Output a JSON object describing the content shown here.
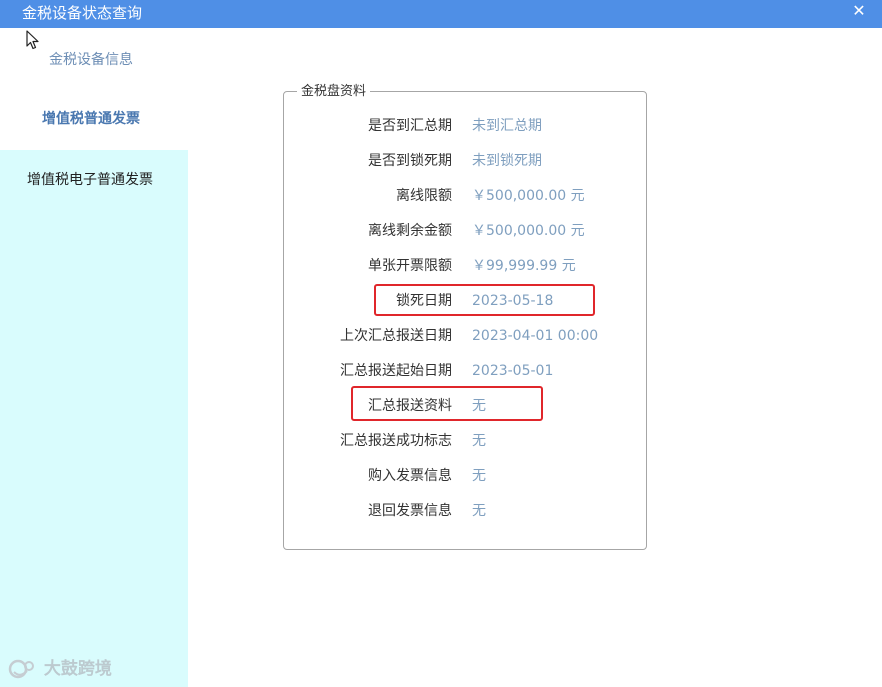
{
  "window": {
    "title": "金税设备状态查询",
    "close_icon": "close-icon"
  },
  "sidebar": {
    "items": [
      {
        "label": "金税设备信息"
      },
      {
        "label": "增值税普通发票"
      },
      {
        "label": "增值税电子普通发票"
      }
    ]
  },
  "panel": {
    "legend": "金税盘资料",
    "rows": [
      {
        "label": "是否到汇总期",
        "value": "未到汇总期"
      },
      {
        "label": "是否到锁死期",
        "value": "未到锁死期"
      },
      {
        "label": "离线限额",
        "value": "￥500,000.00 元"
      },
      {
        "label": "离线剩余金额",
        "value": "￥500,000.00 元"
      },
      {
        "label": "单张开票限额",
        "value": "￥99,999.99 元"
      },
      {
        "label": "锁死日期",
        "value": "2023-05-18"
      },
      {
        "label": "上次汇总报送日期",
        "value": "2023-04-01 00:00"
      },
      {
        "label": "汇总报送起始日期",
        "value": "2023-05-01"
      },
      {
        "label": "汇总报送资料",
        "value": "无"
      },
      {
        "label": "汇总报送成功标志",
        "value": "无"
      },
      {
        "label": "购入发票信息",
        "value": "无"
      },
      {
        "label": "退回发票信息",
        "value": "无"
      }
    ]
  },
  "watermark": {
    "text": "大鼓跨境"
  },
  "colors": {
    "titlebar": "#4f8fe6",
    "sidebar_active_bg": "#d9fcfd",
    "value_text": "#7f9fbf",
    "highlight_border": "#e0262b"
  }
}
